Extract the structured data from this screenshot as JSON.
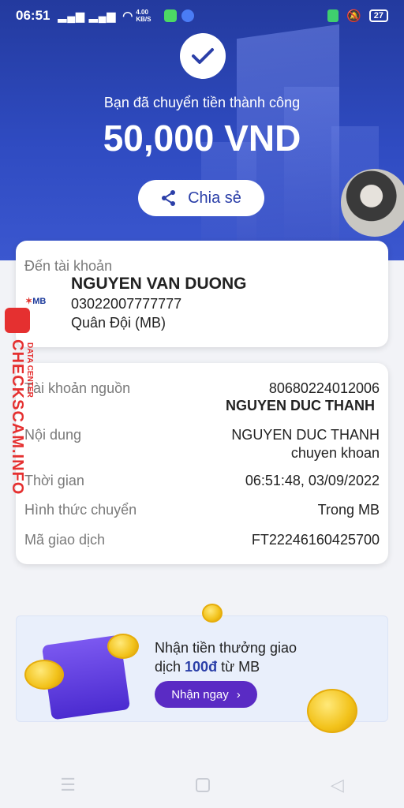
{
  "status_bar": {
    "time": "06:51",
    "speed": "4.00 KB/S",
    "battery": "27"
  },
  "hero": {
    "message": "Bạn đã chuyển tiền thành công",
    "amount": "50,000 VND",
    "share_label": "Chia sẻ"
  },
  "recipient": {
    "heading": "Đến tài khoản",
    "name": "NGUYEN VAN DUONG",
    "account": "03022007777777",
    "bank": "Quân Đội (MB)",
    "bank_logo_text": "MB"
  },
  "details": {
    "source_label": "Tài khoản nguồn",
    "source_account": "80680224012006",
    "source_name": "NGUYEN DUC THANH",
    "content_label": "Nội dung",
    "content_line1": "NGUYEN DUC THANH",
    "content_line2": "chuyen khoan",
    "time_label": "Thời gian",
    "time_value": "06:51:48, 03/09/2022",
    "method_label": "Hình thức chuyển",
    "method_value": "Trong MB",
    "txn_label": "Mã giao dịch",
    "txn_value": "FT22246160425700"
  },
  "promo": {
    "line1": "Nhận tiền thưởng giao",
    "line2_prefix": "dịch ",
    "line2_bold": "100đ",
    "line2_suffix": " từ MB",
    "button_label": "Nhận ngay"
  },
  "watermark": {
    "text": "CHECKSCAM.INFO",
    "sub": "DATA CENTER"
  },
  "colors": {
    "primary": "#2f4bc1",
    "promo_button": "#5a2bc4",
    "watermark": "#e53030"
  }
}
